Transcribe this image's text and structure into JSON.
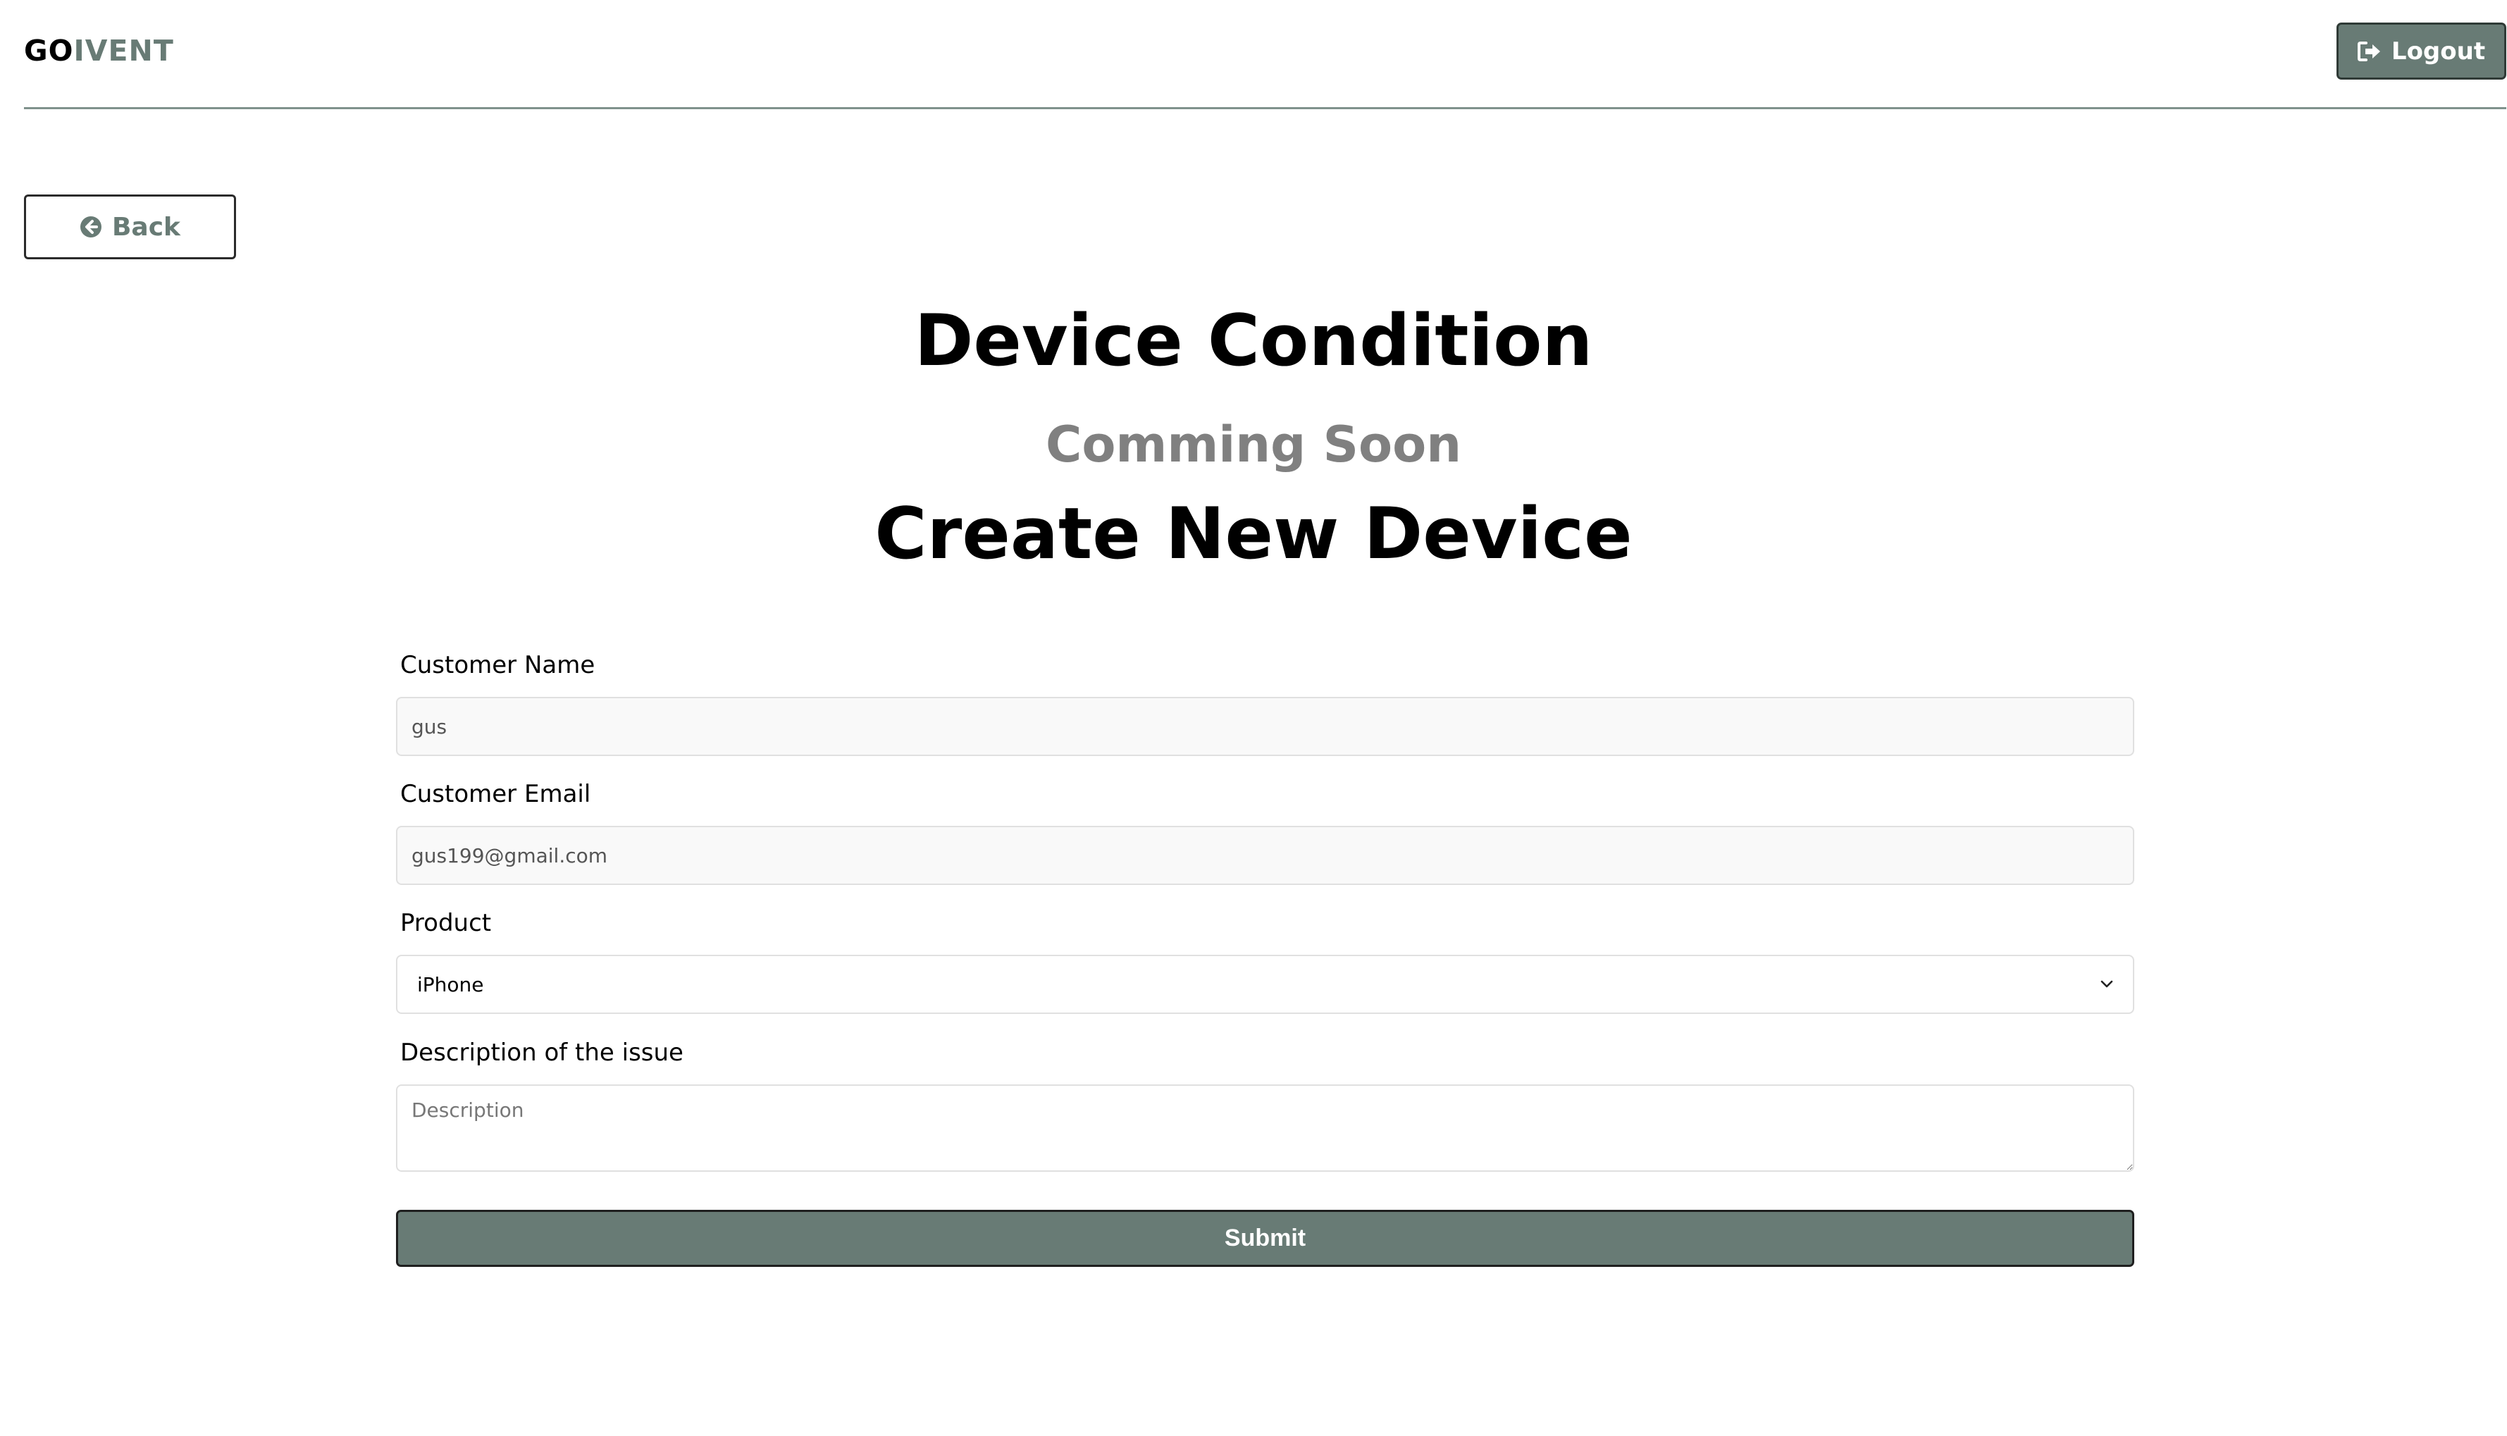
{
  "header": {
    "logo_part1": "GO",
    "logo_part2": "IVENT",
    "logout_label": "Logout",
    "logout_icon": "sign-out-icon"
  },
  "back": {
    "label": "Back",
    "icon": "arrow-circle-left-icon"
  },
  "headings": {
    "device_condition": "Device Condition",
    "coming_soon": "Comming Soon",
    "create_device": "Create New Device"
  },
  "form": {
    "customer_name": {
      "label": "Customer Name",
      "value": "gus"
    },
    "customer_email": {
      "label": "Customer Email",
      "value": "gus199@gmail.com"
    },
    "product": {
      "label": "Product",
      "selected": "iPhone"
    },
    "description": {
      "label": "Description of the issue",
      "placeholder": "Description",
      "value": ""
    },
    "submit_label": "Submit"
  },
  "colors": {
    "accent": "#687b75",
    "muted_heading": "#808080",
    "divider": "#7f928c"
  }
}
